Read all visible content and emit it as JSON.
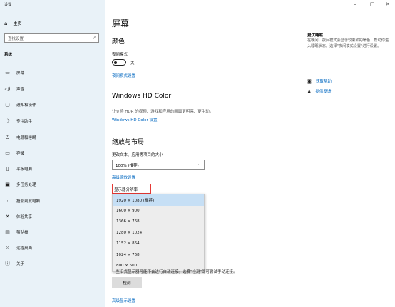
{
  "window": {
    "title": "设置",
    "minimize": "–",
    "maximize": "□",
    "close": "✕"
  },
  "sidebar": {
    "home": "主页",
    "search_placeholder": "查找设置",
    "section": "系统",
    "items": [
      {
        "label": "屏幕",
        "icon": "monitor-icon"
      },
      {
        "label": "声音",
        "icon": "speaker-icon"
      },
      {
        "label": "通知和操作",
        "icon": "notification-icon"
      },
      {
        "label": "专注助手",
        "icon": "moon-icon"
      },
      {
        "label": "电源和睡眠",
        "icon": "power-icon"
      },
      {
        "label": "存储",
        "icon": "storage-icon"
      },
      {
        "label": "平板电脑",
        "icon": "tablet-icon"
      },
      {
        "label": "多任务处理",
        "icon": "multitask-icon"
      },
      {
        "label": "投影到此电脑",
        "icon": "project-icon"
      },
      {
        "label": "体验共享",
        "icon": "share-icon"
      },
      {
        "label": "剪贴板",
        "icon": "clipboard-icon"
      },
      {
        "label": "远程桌面",
        "icon": "remote-icon"
      },
      {
        "label": "关于",
        "icon": "info-icon"
      }
    ]
  },
  "main": {
    "title": "屏幕",
    "color_heading": "颜色",
    "night_mode_label": "夜间模式",
    "night_mode_state": "关",
    "night_mode_settings": "夜间模式设置",
    "hdr_heading": "Windows HD Color",
    "hdr_desc": "让支持 HDR 的视频、游戏和应用的画面更明亮、更生动。",
    "hdr_link": "Windows HD Color 设置",
    "scale_heading": "缩放与布局",
    "scale_label": "更改文本、应用等项目的大小",
    "scale_value": "100% (推荐)",
    "advanced_scale": "高级缩放设置",
    "resolution_label": "显示器分辨率",
    "resolution_options": [
      "1920 × 1080 (推荐)",
      "1600 × 900",
      "1366 × 768",
      "1280 × 1024",
      "1152 × 864",
      "1024 × 768",
      "800 × 600"
    ],
    "bottom_text": "一些旧式显示器可能不会进行自动连接。选择\"检测\"即可尝试手动连接。",
    "detect_button": "检测",
    "advanced_display": "高级显示设置"
  },
  "right": {
    "title": "更优睡眠",
    "desc": "在晚间，夜间模式会显示较柔和的暖色，帮助你进入睡眠状态。选择\"夜间模式设置\"进行设置。",
    "help": "获取帮助",
    "feedback": "提供反馈"
  }
}
